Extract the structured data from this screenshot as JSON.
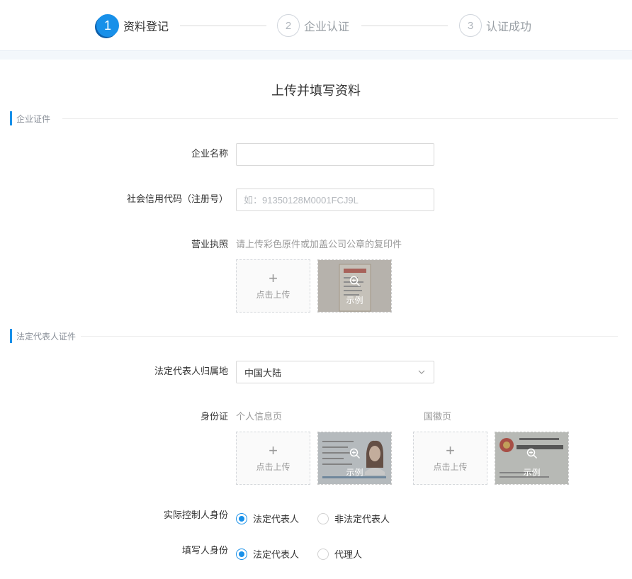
{
  "steps": [
    {
      "num": "1",
      "label": "资料登记"
    },
    {
      "num": "2",
      "label": "企业认证"
    },
    {
      "num": "3",
      "label": "认证成功"
    }
  ],
  "page_title": "上传并填写资料",
  "section_company": "企业证件",
  "section_legal": "法定代表人证件",
  "company_name": {
    "label": "企业名称",
    "value": ""
  },
  "credit_code": {
    "label": "社会信用代码（注册号）",
    "placeholder": "如：91350128M0001FCJ9L"
  },
  "license": {
    "label": "营业执照",
    "hint": "请上传彩色原件或加盖公司公章的复印件"
  },
  "upload_label": "点击上传",
  "sample_label": "示例",
  "region": {
    "label": "法定代表人归属地",
    "value": "中国大陆"
  },
  "id_card": {
    "label": "身份证",
    "front_hint": "个人信息页",
    "back_hint": "国徽页"
  },
  "controller": {
    "label": "实际控制人身份",
    "options": [
      "法定代表人",
      "非法定代表人"
    ],
    "selected": 0
  },
  "filler": {
    "label": "填写人身份",
    "options": [
      "法定代表人",
      "代理人"
    ],
    "selected": 0
  },
  "colors": {
    "accent": "#1890e9"
  }
}
